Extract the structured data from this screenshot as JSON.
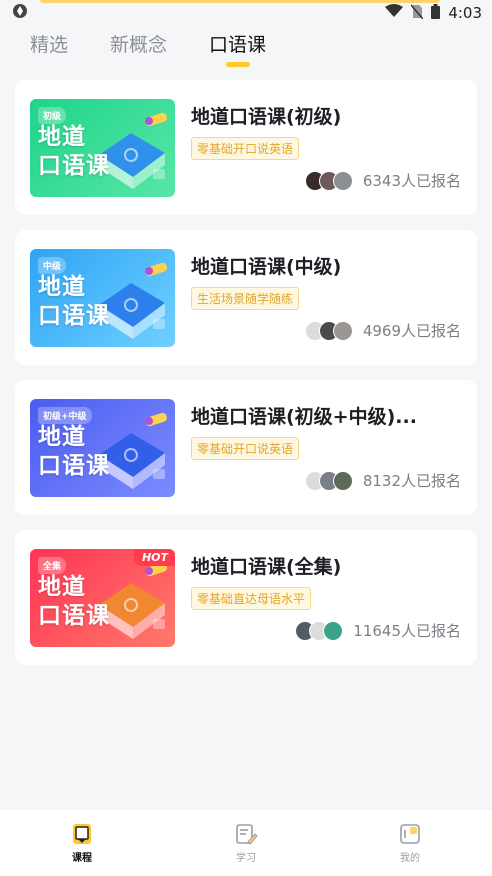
{
  "status_bar": {
    "time": "4:03"
  },
  "tabs": [
    {
      "label": "精选",
      "active": false
    },
    {
      "label": "新概念",
      "active": false
    },
    {
      "label": "口语课",
      "active": true
    }
  ],
  "courses": [
    {
      "title": "地道口语课(初级)",
      "tag": "零基础开口说英语",
      "enrolled": "6343人已报名",
      "thumb_tag": "初级",
      "thumb_title": "地道\n口语课",
      "hot": false,
      "gradient": [
        "#1ed48a",
        "#58e6a6"
      ],
      "book_color": "#2e8cf0",
      "avatar_colors": [
        "#3a2b2b",
        "#6c5a58",
        "#8a8f96"
      ]
    },
    {
      "title": "地道口语课(中级)",
      "tag": "生活场景随学随练",
      "enrolled": "4969人已报名",
      "thumb_tag": "中级",
      "thumb_title": "地道\n口语课",
      "hot": false,
      "gradient": [
        "#2ea4f6",
        "#6fd0ff"
      ],
      "book_color": "#2b7bea",
      "avatar_colors": [
        "#dcdcdc",
        "#4b4b4b",
        "#9d9690"
      ]
    },
    {
      "title": "地道口语课(初级+中级)...",
      "tag": "零基础开口说英语",
      "enrolled": "8132人已报名",
      "thumb_tag": "初级+中级",
      "thumb_title": "地道\n口语课",
      "hot": false,
      "gradient": [
        "#4b5cf0",
        "#7b8cff"
      ],
      "book_color": "#2f5de8",
      "avatar_colors": [
        "#dcdcdc",
        "#7a7f8a",
        "#5d6a5a"
      ]
    },
    {
      "title": "地道口语课(全集)",
      "tag": "零基础直达母语水平",
      "enrolled": "11645人已报名",
      "thumb_tag": "全集",
      "thumb_title": "地道\n口语课",
      "hot": true,
      "hot_label": "HOT",
      "gradient": [
        "#ff3355",
        "#ff7a6a"
      ],
      "book_color": "#f08a2e",
      "avatar_colors": [
        "#555a63",
        "#dcdcdc",
        "#3aa38a"
      ]
    }
  ],
  "bottom_nav": [
    {
      "label": "课程",
      "active": true,
      "icon": "course-icon"
    },
    {
      "label": "学习",
      "active": false,
      "icon": "study-icon"
    },
    {
      "label": "我的",
      "active": false,
      "icon": "profile-icon"
    }
  ],
  "colors": {
    "accent": "#ffc928",
    "tag_text": "#e4a427",
    "background": "#f5f6f8"
  }
}
